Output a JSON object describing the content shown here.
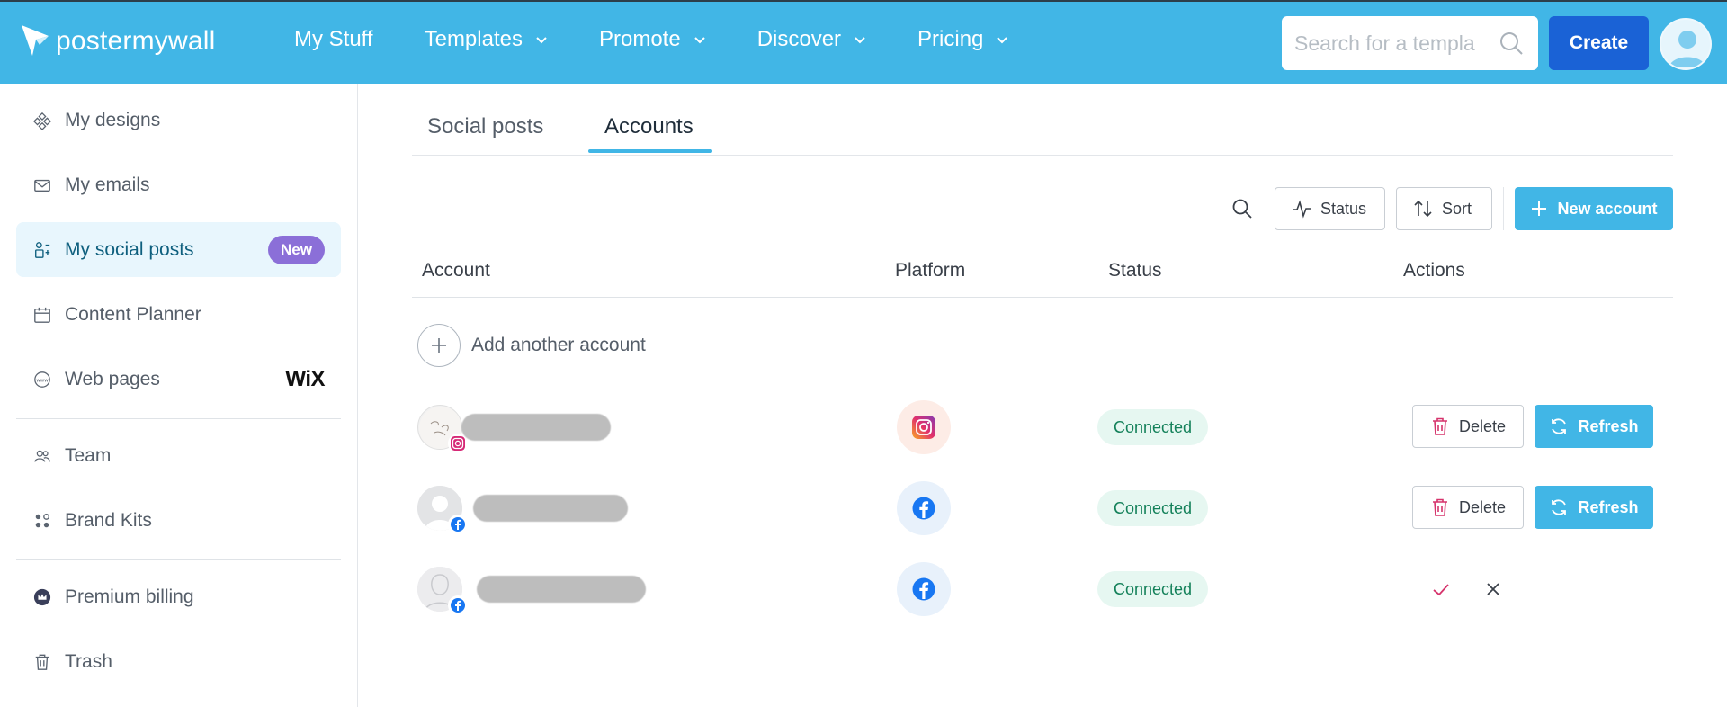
{
  "header": {
    "logo_text": "postermywall",
    "nav": [
      {
        "label": "My Stuff",
        "dropdown": false
      },
      {
        "label": "Templates",
        "dropdown": true
      },
      {
        "label": "Promote",
        "dropdown": true
      },
      {
        "label": "Discover",
        "dropdown": true
      },
      {
        "label": "Pricing",
        "dropdown": true
      }
    ],
    "search_placeholder": "Search for a templa",
    "create_label": "Create"
  },
  "sidebar": {
    "items": [
      {
        "label": "My designs",
        "icon": "designs-icon"
      },
      {
        "label": "My emails",
        "icon": "mail-icon"
      },
      {
        "label": "My social posts",
        "icon": "social-icon",
        "badge": "New",
        "active": true
      },
      {
        "label": "Content Planner",
        "icon": "calendar-icon"
      },
      {
        "label": "Web pages",
        "icon": "www-icon",
        "brand": "WiX"
      },
      {
        "label": "Team",
        "icon": "team-icon"
      },
      {
        "label": "Brand Kits",
        "icon": "brandkit-icon"
      },
      {
        "label": "Premium billing",
        "icon": "crown-icon"
      },
      {
        "label": "Trash",
        "icon": "trash-icon"
      }
    ]
  },
  "tabs": [
    {
      "label": "Social posts",
      "active": false
    },
    {
      "label": "Accounts",
      "active": true
    }
  ],
  "toolbar": {
    "status_label": "Status",
    "sort_label": "Sort",
    "new_account_label": "New account"
  },
  "table": {
    "columns": [
      "Account",
      "Platform",
      "Status",
      "Actions"
    ],
    "add_account_label": "Add another account",
    "rows": [
      {
        "platform": "instagram",
        "status": "Connected",
        "actions": "delete-refresh",
        "delete_label": "Delete",
        "refresh_label": "Refresh"
      },
      {
        "platform": "facebook",
        "status": "Connected",
        "actions": "delete-refresh",
        "delete_label": "Delete",
        "refresh_label": "Refresh"
      },
      {
        "platform": "facebook",
        "status": "Connected",
        "actions": "confirm-cancel"
      }
    ]
  },
  "colors": {
    "brand": "#41b6e6",
    "create": "#1a62d6",
    "new_badge": "#8b6fd8",
    "connected_text": "#14815a",
    "connected_bg": "#e6f7f1"
  }
}
